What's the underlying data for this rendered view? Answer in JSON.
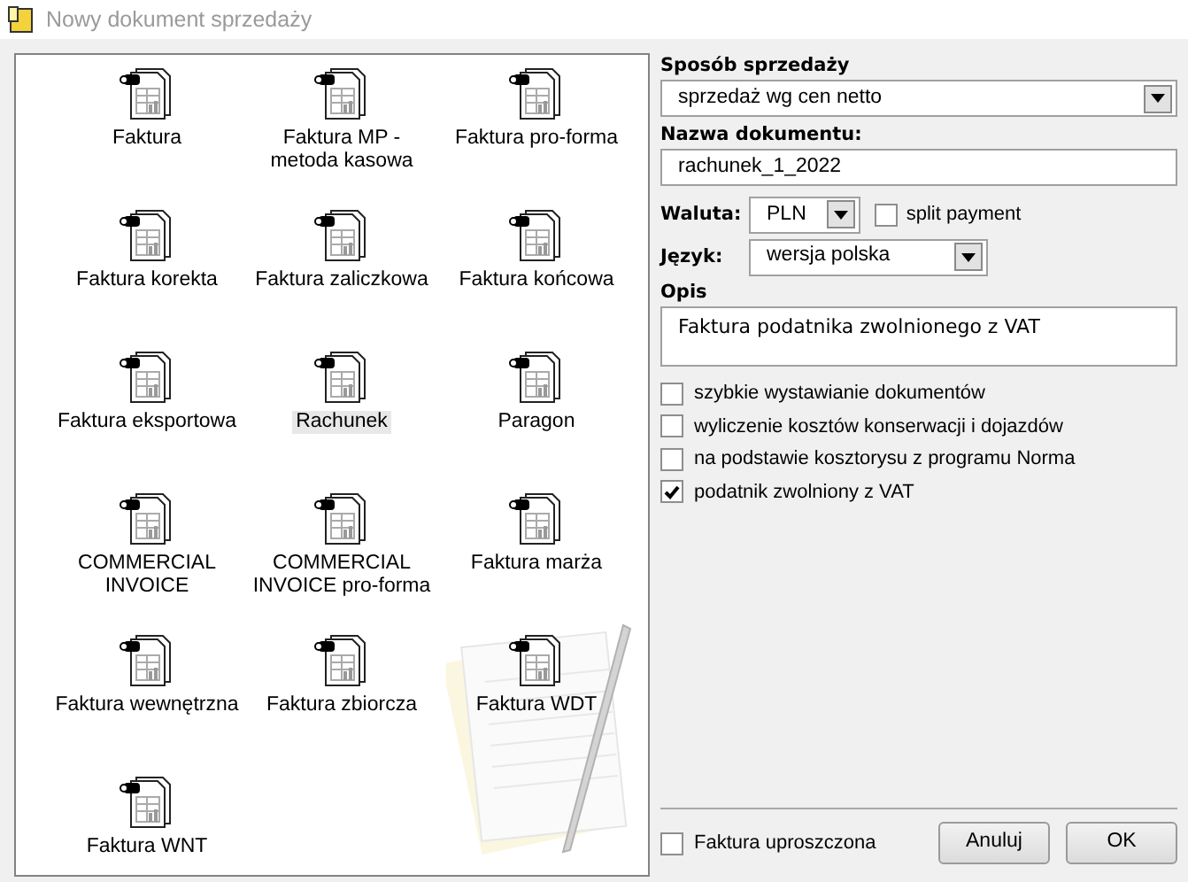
{
  "window": {
    "title": "Nowy dokument sprzedaży"
  },
  "document_types": [
    {
      "label": "Faktura",
      "selected": false
    },
    {
      "label": "Faktura MP - metoda kasowa",
      "selected": false
    },
    {
      "label": "Faktura pro-forma",
      "selected": false
    },
    {
      "label": "Faktura korekta",
      "selected": false
    },
    {
      "label": "Faktura zaliczkowa",
      "selected": false
    },
    {
      "label": "Faktura końcowa",
      "selected": false
    },
    {
      "label": "Faktura eksportowa",
      "selected": false
    },
    {
      "label": "Rachunek",
      "selected": true
    },
    {
      "label": "Paragon",
      "selected": false
    },
    {
      "label": "COMMERCIAL INVOICE",
      "selected": false
    },
    {
      "label": "COMMERCIAL INVOICE pro-forma",
      "selected": false
    },
    {
      "label": "Faktura marża",
      "selected": false
    },
    {
      "label": "Faktura wewnętrzna",
      "selected": false
    },
    {
      "label": "Faktura zbiorcza",
      "selected": false
    },
    {
      "label": "Faktura WDT",
      "selected": false
    },
    {
      "label": "Faktura WNT",
      "selected": false
    }
  ],
  "form": {
    "sale_method": {
      "label": "Sposób sprzedaży",
      "value": "sprzedaż wg cen netto"
    },
    "document_name": {
      "label": "Nazwa dokumentu:",
      "value": "rachunek_1_2022"
    },
    "currency": {
      "label": "Waluta:",
      "value": "PLN"
    },
    "split_payment": {
      "label": "split payment",
      "checked": false
    },
    "language": {
      "label": "Język:",
      "value": "wersja polska"
    },
    "description": {
      "label": "Opis",
      "value": "Faktura podatnika zwolnionego z VAT"
    },
    "options": [
      {
        "label": "szybkie wystawianie dokumentów",
        "checked": false
      },
      {
        "label": "wyliczenie kosztów konserwacji i dojazdów",
        "checked": false
      },
      {
        "label": "na podstawie kosztorysu z programu Norma",
        "checked": false
      },
      {
        "label": "podatnik zwolniony z VAT",
        "checked": true
      }
    ]
  },
  "footer": {
    "simplified_invoice": {
      "label": "Faktura uproszczona",
      "checked": false
    },
    "buttons": [
      "Anuluj",
      "OK"
    ]
  }
}
